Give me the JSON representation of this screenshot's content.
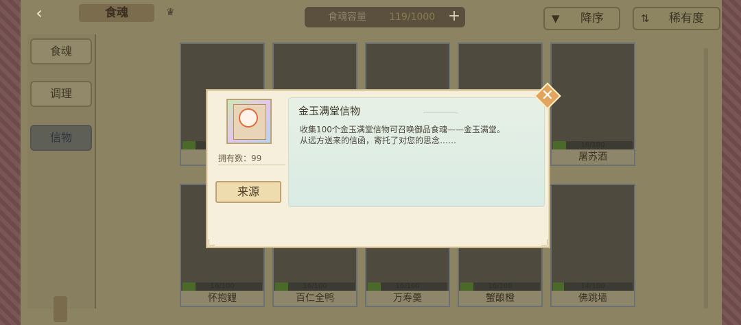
{
  "header": {
    "back_icon": "back-arrow-icon",
    "title": "食魂",
    "crown_icon": "crown-icon",
    "capacity_label": "食魂容量",
    "capacity_value": "119/1000",
    "add_icon": "plus-icon"
  },
  "sort": {
    "order_label": "降序",
    "order_icon": "triangle-down-icon",
    "rarity_label": "稀有度",
    "rarity_icon": "sort-arrows-icon"
  },
  "sidebar": {
    "items": [
      {
        "label": "食魂",
        "active": false
      },
      {
        "label": "调理",
        "active": false
      },
      {
        "label": "信物",
        "active": true
      }
    ]
  },
  "cards": [
    {
      "name": "",
      "progress": "",
      "fill": 0.16
    },
    {
      "name": "",
      "progress": "",
      "fill": 0.16
    },
    {
      "name": "",
      "progress": "",
      "fill": 0.16
    },
    {
      "name": "",
      "progress": "",
      "fill": 0.16
    },
    {
      "name": "屠苏酒",
      "progress": "16/100",
      "fill": 0.16
    },
    {
      "name": "怀抱鲤",
      "progress": "16/100",
      "fill": 0.16
    },
    {
      "name": "百仁全鸭",
      "progress": "16/100",
      "fill": 0.16
    },
    {
      "name": "万寿羹",
      "progress": "16/100",
      "fill": 0.16
    },
    {
      "name": "蟹酿橙",
      "progress": "16/100",
      "fill": 0.16
    },
    {
      "name": "佛跳墙",
      "progress": "14/100",
      "fill": 0.14
    }
  ],
  "dialog": {
    "item_name": "金玉满堂信物",
    "item_desc_line1": "收集100个金玉满堂信物可召唤御品食魂——金玉满堂。",
    "item_desc_line2": "从远方送来的信函，寄托了对您的思念……",
    "owned_label": "拥有数：99",
    "source_label": "来源",
    "close_icon": "close-x-icon"
  },
  "colors": {
    "dialog_bg": "#f6efdc",
    "desc_bg": "#ddece5",
    "close_accent": "#e3a45e"
  }
}
